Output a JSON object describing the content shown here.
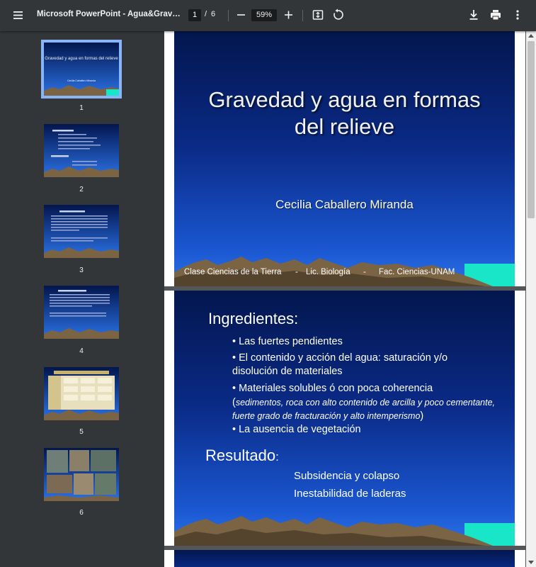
{
  "toolbar": {
    "title": "Microsoft PowerPoint - Agua&Gravedad...",
    "current_page": "1",
    "page_separator": "/",
    "total_pages": "6",
    "zoom": "59%",
    "icons": [
      "menu-icon",
      "zoom-out-icon",
      "zoom-in-icon",
      "fit-page-icon",
      "rotate-icon",
      "download-icon",
      "print-icon",
      "more-options-icon"
    ]
  },
  "sidebar": {
    "thumbnails": [
      {
        "number": "1",
        "selected": true,
        "title": "Gravedad y agua en formas del relieve",
        "subtitle": "Cecilia Caballero Miranda"
      },
      {
        "number": "2",
        "selected": false
      },
      {
        "number": "3",
        "selected": false
      },
      {
        "number": "4",
        "selected": false
      },
      {
        "number": "5",
        "selected": false
      },
      {
        "number": "6",
        "selected": false
      }
    ]
  },
  "slide1": {
    "title_line1": "Gravedad y agua en formas",
    "title_line2": "del relieve",
    "author": "Cecilia Caballero Miranda",
    "footer": [
      "Clase Ciencias de la Tierra",
      "-",
      "Lic. Biología",
      "-",
      "Fac. Ciencias-UNAM"
    ]
  },
  "slide2": {
    "heading": "Ingredientes:",
    "bullets": [
      "• Las fuertes pendientes",
      "• El contenido y acción del agua: saturación y/o disolución de materiales",
      "• Materiales solubles ó con poca coherencia",
      "• La ausencia de vegetación"
    ],
    "paren_open": "(",
    "italic_note": "sedimentos, roca con alto contenido de arcilla y poco cementante, fuerte grado de fracturación y alto intemperismo",
    "paren_close": ")",
    "result_heading": "Resultado",
    "result_colon": ":",
    "results": [
      "Subsidencia y colapso",
      "Inestabilidad de laderas"
    ]
  },
  "colors": {
    "toolbar": "#323639",
    "viewer_bg": "#525659",
    "selection": "#8ab4f8",
    "slide_dark": "#03164e",
    "slide_light": "#2b72e6",
    "mountain": "#7a6444",
    "sea": "#19e6c8"
  }
}
